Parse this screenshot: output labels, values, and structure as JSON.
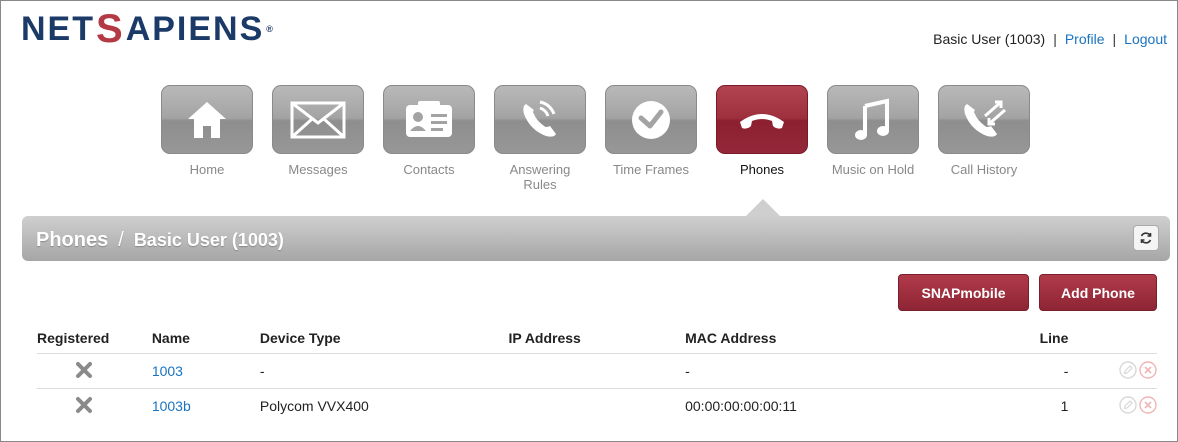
{
  "brand": {
    "logo_pre": "NET",
    "logo_s": "S",
    "logo_post": "APIENS",
    "logo_reg": "®"
  },
  "user_nav": {
    "user": "Basic User (1003)",
    "profile": "Profile",
    "logout": "Logout",
    "sep": "|"
  },
  "nav": [
    {
      "label": "Home",
      "icon": "home-icon"
    },
    {
      "label": "Messages",
      "icon": "envelope-icon"
    },
    {
      "label": "Contacts",
      "icon": "contact-card-icon"
    },
    {
      "label": "Answering Rules",
      "icon": "answering-phone-icon"
    },
    {
      "label": "Time Frames",
      "icon": "clock-icon"
    },
    {
      "label": "Phones",
      "icon": "handset-icon",
      "active": true
    },
    {
      "label": "Music on Hold",
      "icon": "music-note-icon"
    },
    {
      "label": "Call History",
      "icon": "call-history-icon"
    }
  ],
  "page": {
    "title": "Phones",
    "sep": "/",
    "subtitle": "Basic User (1003)"
  },
  "buttons": {
    "snap": "SNAPmobile",
    "add": "Add Phone"
  },
  "table": {
    "headers": {
      "registered": "Registered",
      "name": "Name",
      "device": "Device Type",
      "ip": "IP Address",
      "mac": "MAC Address",
      "line": "Line"
    },
    "rows": [
      {
        "registered": false,
        "name": "1003",
        "device": "-",
        "ip": "",
        "mac": "-",
        "line": "-"
      },
      {
        "registered": false,
        "name": "1003b",
        "device": "Polycom VVX400",
        "ip": "",
        "mac": "00:00:00:00:00:11",
        "line": "1"
      }
    ]
  },
  "colors": {
    "accent": "#9b2c3c",
    "link": "#1a73c0",
    "tile_gray": "#a3a3a3"
  }
}
